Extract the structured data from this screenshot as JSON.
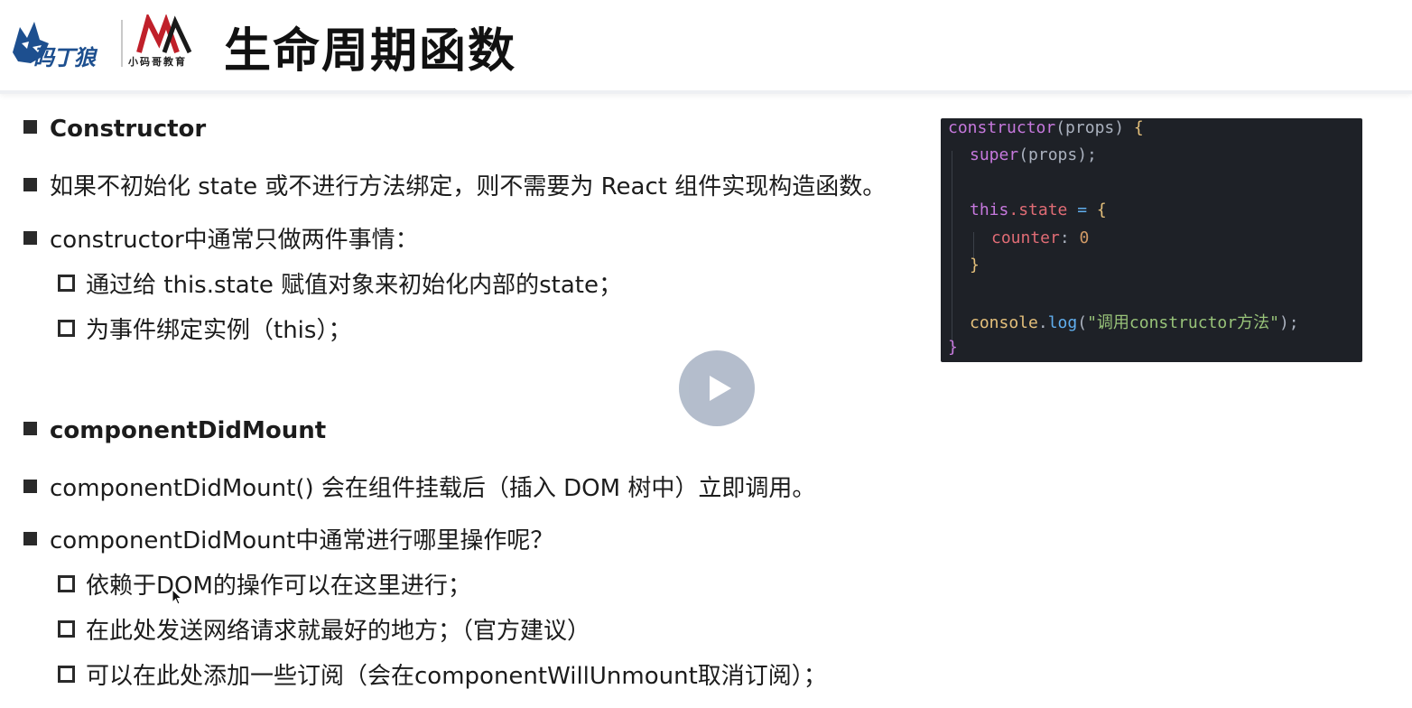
{
  "header": {
    "logo_left_text": "码丁狼",
    "logo_right_text": "小码哥教育",
    "title": "生命周期函数"
  },
  "section1": {
    "heading": "Constructor",
    "line1": "如果不初始化 state 或不进行方法绑定，则不需要为 React 组件实现构造函数。",
    "line2": "constructor中通常只做两件事情：",
    "sub1": "通过给 this.state 赋值对象来初始化内部的state；",
    "sub2": "为事件绑定实例（this）；"
  },
  "section2": {
    "heading": "componentDidMount",
    "line1": "componentDidMount() 会在组件挂载后（插入 DOM 树中）立即调用。",
    "line2": "componentDidMount中通常进行哪里操作呢？",
    "sub1": "依赖于DOM的操作可以在这里进行；",
    "sub2": "在此处发送网络请求就最好的地方；（官方建议）",
    "sub3": "可以在此处添加一些订阅（会在componentWillUnmount取消订阅）；"
  },
  "code": {
    "t_constructor": "constructor",
    "t_props_open": "(props) ",
    "t_brace_open": "{",
    "t_super": "super",
    "t_super_args": "(props);",
    "t_this": "this",
    "t_dot_state": ".state ",
    "t_eq": "= ",
    "t_obj_open": "{",
    "t_counter": "counter",
    "t_colon": ": ",
    "t_zero": "0",
    "t_obj_close": "}",
    "t_console": "console",
    "t_dot": ".",
    "t_log": "log",
    "t_paren_open": "(",
    "t_string": "\"调用constructor方法\"",
    "t_paren_close": ");",
    "t_brace_close": "}"
  },
  "colors": {
    "code_bg": "#1e2127",
    "keyword": "#c678dd",
    "function": "#61afef",
    "string": "#98c379",
    "number": "#d19a66",
    "play_button": "#aeb8c8"
  },
  "icons": {
    "play": "play-icon",
    "cursor": "mouse-cursor-icon"
  }
}
